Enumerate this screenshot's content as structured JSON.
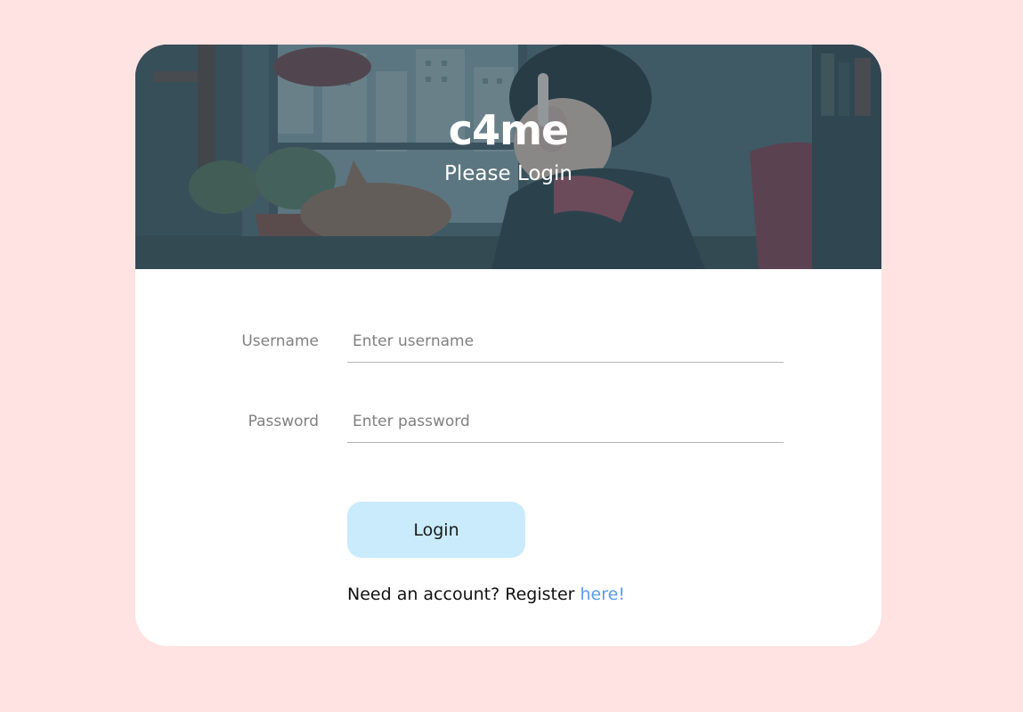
{
  "brand": {
    "title": "c4me",
    "subtitle": "Please Login"
  },
  "form": {
    "username": {
      "label": "Username",
      "placeholder": "Enter username",
      "value": ""
    },
    "password": {
      "label": "Password",
      "placeholder": "Enter password",
      "value": ""
    },
    "login_label": "Login",
    "register_prompt": "Need an account? Register",
    "register_link": "here!"
  },
  "colors": {
    "page_background": "#ffe2e2",
    "card_background": "#ffffff",
    "button_background": "#c9ebfc",
    "link": "#5a9de8",
    "label": "#808080"
  }
}
